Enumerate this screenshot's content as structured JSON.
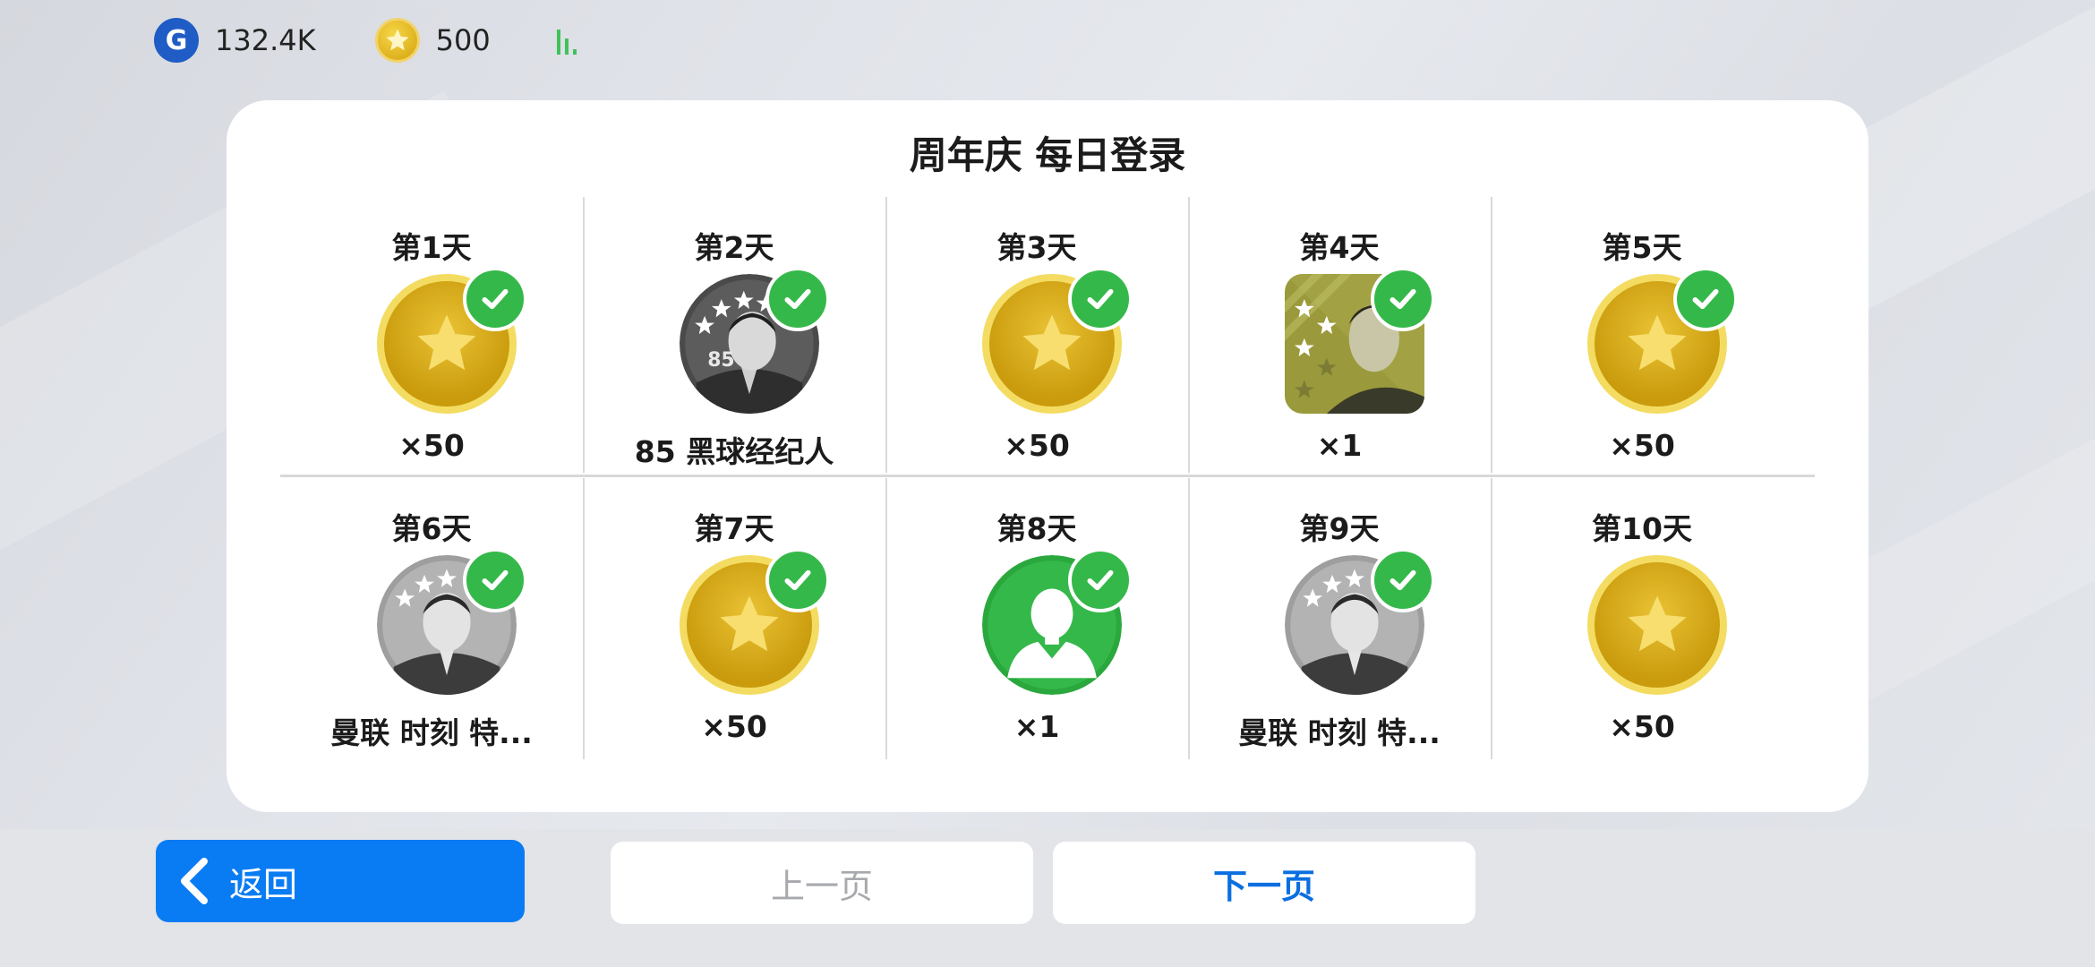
{
  "status": {
    "g_currency": {
      "icon": "g-coin-icon",
      "value": "132.4K"
    },
    "star_currency": {
      "icon": "star-coin-icon",
      "value": "500"
    },
    "signal_icon": "signal-bars-icon"
  },
  "panel": {
    "title": "周年庆 每日登录",
    "days": [
      {
        "day": "第1天",
        "icon": "gold-coin-icon",
        "label": "×50",
        "claimed": true
      },
      {
        "day": "第2天",
        "icon": "black-ball-agent-85-icon",
        "label": "85 黑球经纪人",
        "claimed": true
      },
      {
        "day": "第3天",
        "icon": "gold-coin-icon",
        "label": "×50",
        "claimed": true
      },
      {
        "day": "第4天",
        "icon": "featured-player-card-icon",
        "label": "×1",
        "claimed": true
      },
      {
        "day": "第5天",
        "icon": "gold-coin-icon",
        "label": "×50",
        "claimed": true
      },
      {
        "day": "第6天",
        "icon": "player-silver-agent-icon",
        "label": "曼联 时刻 特...",
        "claimed": true
      },
      {
        "day": "第7天",
        "icon": "gold-coin-icon",
        "label": "×50",
        "claimed": true
      },
      {
        "day": "第8天",
        "icon": "green-manager-icon",
        "label": "×1",
        "claimed": true
      },
      {
        "day": "第9天",
        "icon": "player-silver-agent-icon",
        "label": "曼联 时刻 特...",
        "claimed": true
      },
      {
        "day": "第10天",
        "icon": "gold-coin-icon",
        "label": "×50",
        "claimed": false
      }
    ]
  },
  "buttons": {
    "back": "返回",
    "prev": "上一页",
    "next": "下一页"
  },
  "colors": {
    "accent_blue": "#0a7cf3",
    "claimed_green": "#35b84a",
    "coin_gold": "#e2b61f"
  }
}
